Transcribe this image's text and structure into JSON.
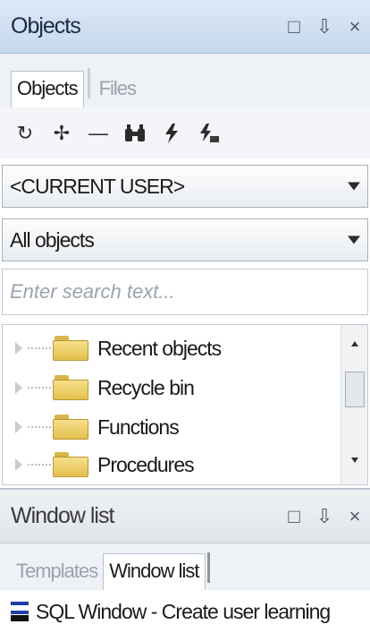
{
  "objects_panel": {
    "title": "Objects",
    "controls": {
      "window": "□",
      "pin": "⇩",
      "close": "×"
    },
    "tabs": [
      {
        "label": "Objects",
        "active": true
      },
      {
        "label": "Files",
        "active": false
      }
    ],
    "toolbar_icons": [
      "refresh-icon",
      "add-icon",
      "remove-icon",
      "find-icon",
      "filter-icon",
      "filter-edit-icon"
    ],
    "toolbar_glyphs": {
      "refresh": "↻",
      "add": "✢",
      "remove": "—",
      "find": "⚲",
      "filter": "ϟ",
      "filter_edit": "ϟ"
    },
    "user_dropdown": {
      "value": "<CURRENT USER>"
    },
    "filter_dropdown": {
      "value": "All objects"
    },
    "search": {
      "placeholder": "Enter search text...",
      "value": ""
    },
    "tree_items": [
      {
        "label": "Recent objects"
      },
      {
        "label": "Recycle bin"
      },
      {
        "label": "Functions"
      },
      {
        "label": "Procedures"
      }
    ]
  },
  "window_list_panel": {
    "title": "Window list",
    "controls": {
      "window": "□",
      "pin": "⇩",
      "close": "×"
    },
    "tabs": [
      {
        "label": "Templates",
        "active": false
      },
      {
        "label": "Window list",
        "active": true
      }
    ],
    "entries": [
      {
        "label": "SQL Window - Create user learning"
      }
    ]
  },
  "colors": {
    "titlebar_active": "#c6d9ee",
    "folder": "#e3bf4e",
    "sql_icon": "#1f3fa6"
  }
}
